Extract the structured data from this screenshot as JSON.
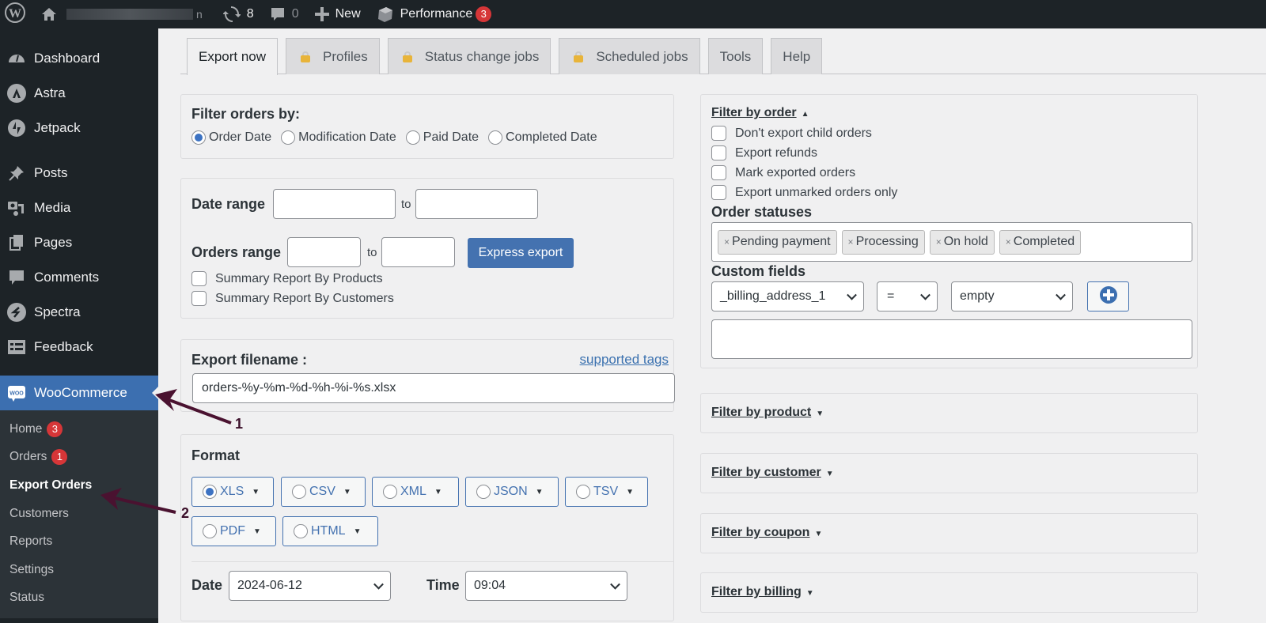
{
  "adminbar": {
    "wp_logo": "wordpress-logo-icon",
    "home_icon": "home-icon",
    "site_name_suffix": "n",
    "updates_count": "8",
    "comments_count": "0",
    "new_label": "New",
    "performance_label": "Performance",
    "performance_badge": "3"
  },
  "sidebar": {
    "items": [
      {
        "label": "Dashboard",
        "icon": "dashboard-icon"
      },
      {
        "label": "Astra",
        "icon": "astra-icon"
      },
      {
        "label": "Jetpack",
        "icon": "jetpack-icon"
      },
      {
        "label": "Posts",
        "icon": "pin-icon"
      },
      {
        "label": "Media",
        "icon": "media-icon"
      },
      {
        "label": "Pages",
        "icon": "pages-icon"
      },
      {
        "label": "Comments",
        "icon": "comment-icon"
      },
      {
        "label": "Spectra",
        "icon": "spectra-icon"
      },
      {
        "label": "Feedback",
        "icon": "feedback-icon"
      },
      {
        "label": "WooCommerce",
        "icon": "woo-icon"
      }
    ],
    "submenu": [
      {
        "label": "Home",
        "badge": "3"
      },
      {
        "label": "Orders",
        "badge": "1"
      },
      {
        "label": "Export Orders"
      },
      {
        "label": "Customers"
      },
      {
        "label": "Reports"
      },
      {
        "label": "Settings"
      },
      {
        "label": "Status"
      }
    ]
  },
  "annotations": {
    "arrow1": "1",
    "arrow2": "2"
  },
  "tabs": [
    {
      "label": "Export now",
      "locked": false,
      "active": true
    },
    {
      "label": "Profiles",
      "locked": true
    },
    {
      "label": "Status change jobs",
      "locked": true
    },
    {
      "label": "Scheduled jobs",
      "locked": true
    },
    {
      "label": "Tools",
      "locked": false
    },
    {
      "label": "Help",
      "locked": false
    }
  ],
  "filter_orders_by": {
    "title": "Filter orders by:",
    "options": [
      "Order Date",
      "Modification Date",
      "Paid Date",
      "Completed Date"
    ],
    "selected": "Order Date"
  },
  "ranges": {
    "date_range_label": "Date range",
    "to_label": "to",
    "date_from": "",
    "date_to": "",
    "orders_range_label": "Orders range",
    "orders_from": "",
    "orders_to": "",
    "express_export": "Express export",
    "summary_products": "Summary Report By Products",
    "summary_customers": "Summary Report By Customers"
  },
  "filename": {
    "label": "Export filename :",
    "supported_tags": "supported tags",
    "value": "orders-%y-%m-%d-%h-%i-%s.xlsx"
  },
  "format": {
    "title": "Format",
    "options": [
      "XLS",
      "CSV",
      "XML",
      "JSON",
      "TSV",
      "PDF",
      "HTML"
    ],
    "selected": "XLS",
    "date_label": "Date",
    "date_value": "2024-06-12",
    "time_label": "Time",
    "time_value": "09:04"
  },
  "filter_by_order": {
    "title": "Filter by order",
    "checkboxes": [
      "Don't export child orders",
      "Export refunds",
      "Mark exported orders",
      "Export unmarked orders only"
    ],
    "order_statuses_label": "Order statuses",
    "statuses": [
      "Pending payment",
      "Processing",
      "On hold",
      "Completed"
    ],
    "custom_fields_label": "Custom fields",
    "field_select": "_billing_address_1",
    "operator_select": "=",
    "value_select": "empty",
    "custom_fields_text": ""
  },
  "collapsed_filters": [
    "Filter by product",
    "Filter by customer",
    "Filter by coupon",
    "Filter by billing"
  ]
}
